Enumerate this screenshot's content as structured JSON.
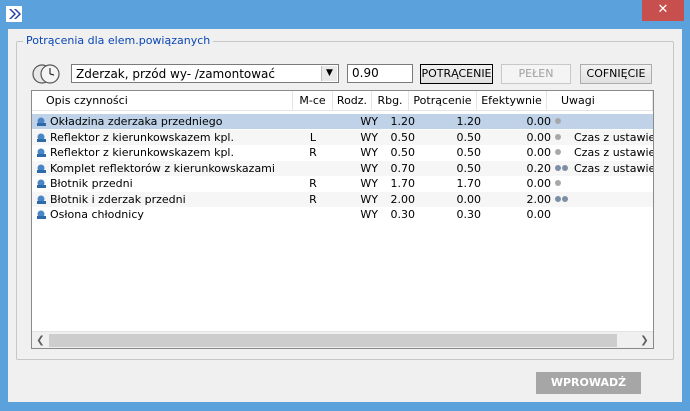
{
  "titlebar": {
    "close_label": "✕"
  },
  "group": {
    "legend": "Potrącenia dla elem.powiązanych"
  },
  "toolbar": {
    "combo_value": "Zderzak, przód wy- /zamontować",
    "factor_value": "0.90",
    "btn_deduct": "POTRĄCENIE",
    "btn_full": "PEŁEN",
    "btn_undo": "COFNIĘCIE"
  },
  "table": {
    "columns": [
      "Opis czynności",
      "M-ce",
      "Rodz.",
      "Rbg.",
      "Potrącenie",
      "Efektywnie",
      "Uwagi"
    ],
    "rows": [
      {
        "desc": "Okładzina zderzaka przedniego",
        "mce": "",
        "rodz": "WY",
        "rbg": "1.20",
        "potr": "1.20",
        "efekt": "0.00",
        "dots": 1,
        "uwagi": ""
      },
      {
        "desc": "Reflektor z kierunkowskazem kpl.",
        "mce": "L",
        "rodz": "WY",
        "rbg": "0.50",
        "potr": "0.50",
        "efekt": "0.00",
        "dots": 1,
        "uwagi": "Czas z ustawieni"
      },
      {
        "desc": "Reflektor z kierunkowskazem kpl.",
        "mce": "R",
        "rodz": "WY",
        "rbg": "0.50",
        "potr": "0.50",
        "efekt": "0.00",
        "dots": 1,
        "uwagi": "Czas z ustawieni"
      },
      {
        "desc": "Komplet reflektorów z kierunkowskazami",
        "mce": "",
        "rodz": "WY",
        "rbg": "0.70",
        "potr": "0.50",
        "efekt": "0.20",
        "dots": 2,
        "uwagi": "Czas z ustawieni"
      },
      {
        "desc": "Błotnik przedni",
        "mce": "R",
        "rodz": "WY",
        "rbg": "1.70",
        "potr": "1.70",
        "efekt": "0.00",
        "dots": 1,
        "uwagi": ""
      },
      {
        "desc": "Błotnik i zderzak przedni",
        "mce": "R",
        "rodz": "WY",
        "rbg": "2.00",
        "potr": "0.00",
        "efekt": "2.00",
        "dots": 2,
        "uwagi": ""
      },
      {
        "desc": "Osłona chłodnicy",
        "mce": "",
        "rodz": "WY",
        "rbg": "0.30",
        "potr": "0.30",
        "efekt": "0.00",
        "dots": 0,
        "uwagi": ""
      }
    ],
    "selected_row": 0
  },
  "footer": {
    "apply_label": "WPROWADŹ"
  },
  "icons": {
    "app": "double-chevron-icon",
    "clock": "clock-icon",
    "row": "mechanic-icon",
    "status": "status-dot-icon"
  },
  "colors": {
    "frame": "#5ba2dc",
    "close": "#c74f4d",
    "legend": "#0a46b4",
    "selected": "#bfd2e8"
  }
}
